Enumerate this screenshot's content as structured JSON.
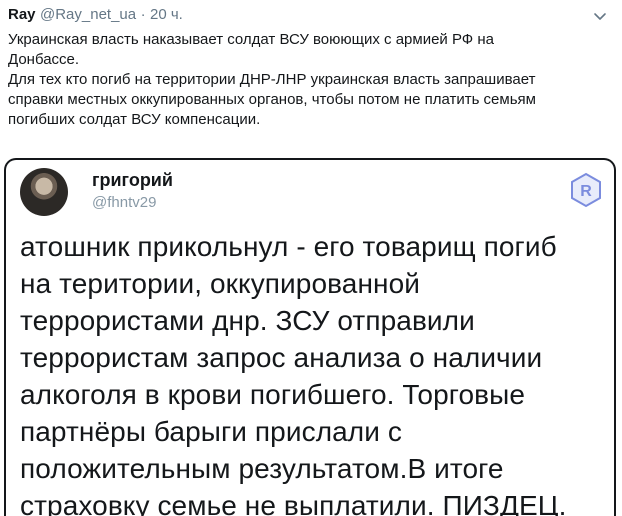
{
  "tweet": {
    "display_name": "Ray",
    "handle": "@Ray_net_ua",
    "separator": "·",
    "time": "20 ч.",
    "text_lines": [
      "Украинская власть наказывает солдат ВСУ воюющих с армией РФ на",
      "Донбассе.",
      "Для тех кто погиб на территории ДНР-ЛНР украинская власть запрашивает",
      "справки местных оккупированных органов, чтобы потом не платить семьям",
      "погибших солдат ВСУ компенсации."
    ]
  },
  "quoted": {
    "name": "григорий",
    "handle": "@fhntv29",
    "badge_letter": "R",
    "lines": [
      "атошник прикольнул - его товарищ погиб",
      "на територии, оккупированной",
      "террористами днр. ЗСУ отправили",
      "террористам запрос анализа о наличии",
      "алкоголя в крови погибшего. Торговые",
      "партнёры барыги прислали с",
      "положительным результатом.В итоге",
      "страховку семье не выплатили. ПИЗДЕЦ."
    ]
  },
  "icons": {
    "menu": "chevron-down-icon",
    "badge": "r-badge-icon",
    "avatar": "avatar"
  },
  "colors": {
    "text": "#14171a",
    "muted": "#657786",
    "badge": "#7b8cde"
  }
}
